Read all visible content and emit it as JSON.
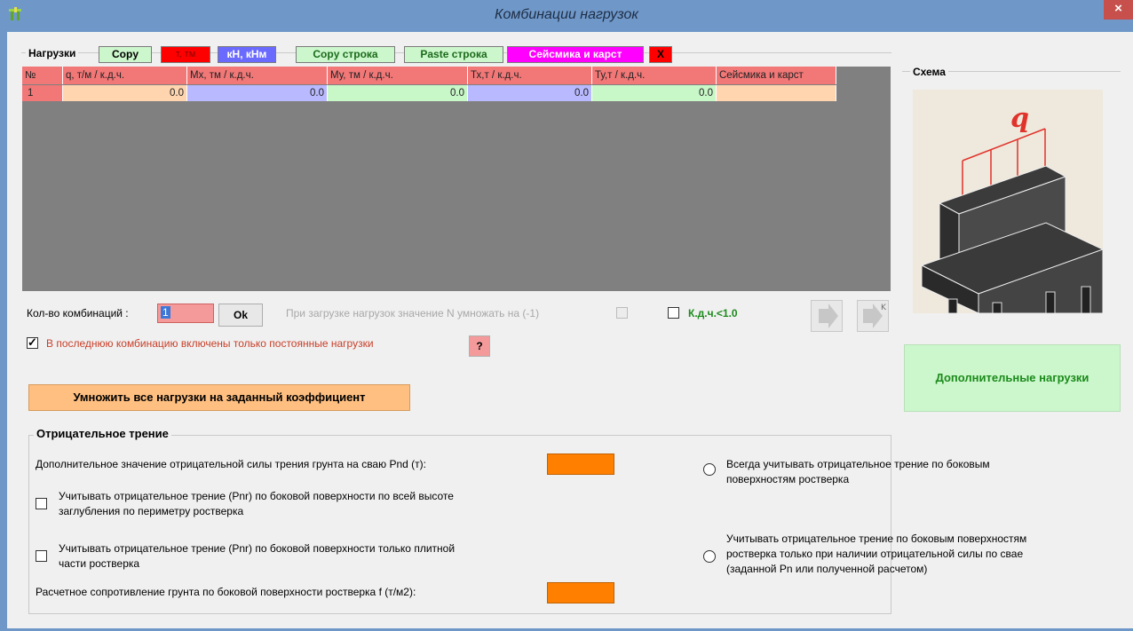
{
  "window": {
    "title": "Комбинации нагрузок",
    "close": "×"
  },
  "loads": {
    "label": "Нагрузки",
    "copy": "Copy",
    "units_t": "т, тм",
    "units_kn": "кН, кНм",
    "copy_row": "Copy строка",
    "paste_row": "Paste строка",
    "seismic": "Сейсмика и карст",
    "delete": "X"
  },
  "grid": {
    "headers": [
      "№",
      "q, т/м / к.д.ч.",
      "Мх, тм / к.д.ч.",
      "Му, тм / к.д.ч.",
      "Тх,т / к.д.ч.",
      "Ту,т / к.д.ч.",
      "Сейсмика и карст"
    ],
    "row": [
      "1",
      "0.0",
      "0.0",
      "0.0",
      "0.0",
      "0.0",
      ""
    ]
  },
  "combos": {
    "label": "Кол-во комбинаций :",
    "value": "1",
    "ok": "Ok",
    "negate_label": "При загрузке нагрузок значение N умножать на (-1)",
    "kdch_label": "К.д.ч.<1.0",
    "last_perm_label": "В последнюю комбинацию включены только постоянные нагрузки",
    "help": "?",
    "multiply_button": "Умножить все нагрузки на заданный коэффициент"
  },
  "scheme": {
    "label": "Схема",
    "q": "q"
  },
  "extra_loads": "Дополнительные нагрузки",
  "friction": {
    "label": "Отрицательное трение",
    "pnd_label": "Дополнительное значение отрицательной силы трения грунта на сваю Pnd (т):",
    "opt1_line1": "Учитывать отрицательное трение (Pnr) по боковой поверхности по всей высоте",
    "opt1_line2": "заглубления по периметру ростверка",
    "opt2_line1": "Учитывать отрицательное трение (Pnr) по боковой поверхности только плитной",
    "opt2_line2": "части ростверка",
    "f_label": "Расчетное сопротивление грунта по боковой поверхности ростверка f (т/м2):",
    "radio1_line1": "Всегда учитывать отрицательное трение по боковым",
    "radio1_line2": "поверхностям ростверка",
    "radio2_line1": "Учитывать отрицательное трение по боковым поверхностям",
    "radio2_line2": "ростверка только при наличии отрицательной силы по свае",
    "radio2_line3": "(заданной Pn или полученной расчетом)"
  },
  "colors": {
    "title_bar": "#6f98c9",
    "header_red": "#f27777",
    "orange": "#ff8000",
    "green_panel": "#ccf7cc"
  }
}
